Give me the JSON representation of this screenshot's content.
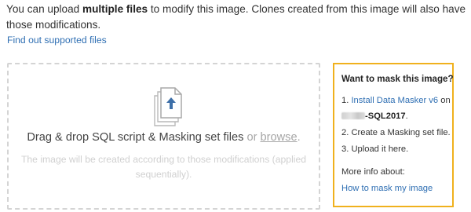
{
  "intro": {
    "text_before": "You can upload ",
    "text_bold": "multiple files",
    "text_after": " to modify this image. Clones created from this image will also have those modifications."
  },
  "supported_link": "Find out supported files",
  "dropzone": {
    "icon": "upload-files-icon",
    "main_text": "Drag & drop SQL script & Masking set files",
    "or_text": " or ",
    "browse_text": "browse",
    "period": ".",
    "sub_text": "The image will be created according to those modifications (applied sequentially)."
  },
  "mask_panel": {
    "title": "Want to mask this image?",
    "step1_prefix": "1. ",
    "step1_link": "Install Data Masker v6",
    "step1_suffix": " on",
    "server_name_suffix": "-SQL2017",
    "server_period": ".",
    "step2": "2. Create a Masking set file.",
    "step3": "3. Upload it here.",
    "more_info": "More info about:",
    "how_to_link": "How to mask my image"
  },
  "colors": {
    "link": "#2f6fb3",
    "panel_border": "#f0b11d",
    "dashed_border": "#d4d4d4",
    "upload_icon_accent": "#3d6fa8"
  }
}
